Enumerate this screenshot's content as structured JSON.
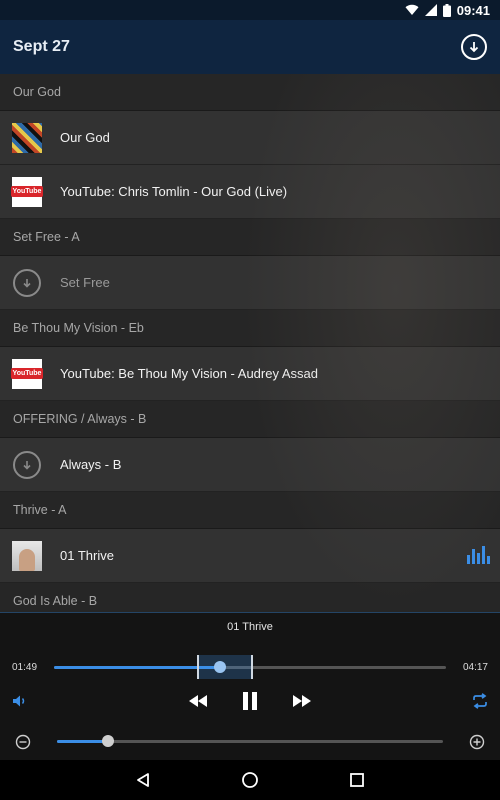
{
  "status_bar": {
    "time": "09:41",
    "icons": [
      "wifi-icon",
      "cell-signal-icon",
      "battery-icon"
    ]
  },
  "app_bar": {
    "title": "Sept 27",
    "action_icon": "download-circle-icon"
  },
  "sections": [
    {
      "header": "Our God",
      "items": [
        {
          "icon": "album-art-our-god",
          "label": "Our God"
        },
        {
          "icon": "youtube-icon",
          "label": "YouTube: Chris Tomlin - Our God (Live)"
        }
      ]
    },
    {
      "header": "Set Free - A",
      "items": [
        {
          "icon": "download-icon",
          "label": "Set Free"
        }
      ]
    },
    {
      "header": "Be Thou My Vision - Eb",
      "items": [
        {
          "icon": "youtube-icon",
          "label": "YouTube: Be Thou My Vision - Audrey Assad"
        }
      ]
    },
    {
      "header": "OFFERING / Always - B",
      "items": [
        {
          "icon": "download-icon",
          "label": "Always - B"
        }
      ]
    },
    {
      "header": "Thrive - A",
      "items": [
        {
          "icon": "album-art-thrive",
          "label": "01 Thrive",
          "playing_icon": "equalizer-icon"
        }
      ]
    },
    {
      "header": "God Is Able - B",
      "items": []
    }
  ],
  "youtube_badge": "YouTube",
  "player": {
    "now_playing": "01 Thrive",
    "elapsed": "01:49",
    "duration": "04:17",
    "progress_fraction": 0.424,
    "volume_fraction": 0.132,
    "icons": [
      "volume-icon",
      "rewind-icon",
      "pause-icon",
      "fast-forward-icon",
      "repeat-icon",
      "minus-icon",
      "plus-icon"
    ],
    "accent": "#3b8ee6"
  },
  "nav_bar": {
    "icons": [
      "back-icon",
      "home-icon",
      "recents-icon"
    ]
  }
}
